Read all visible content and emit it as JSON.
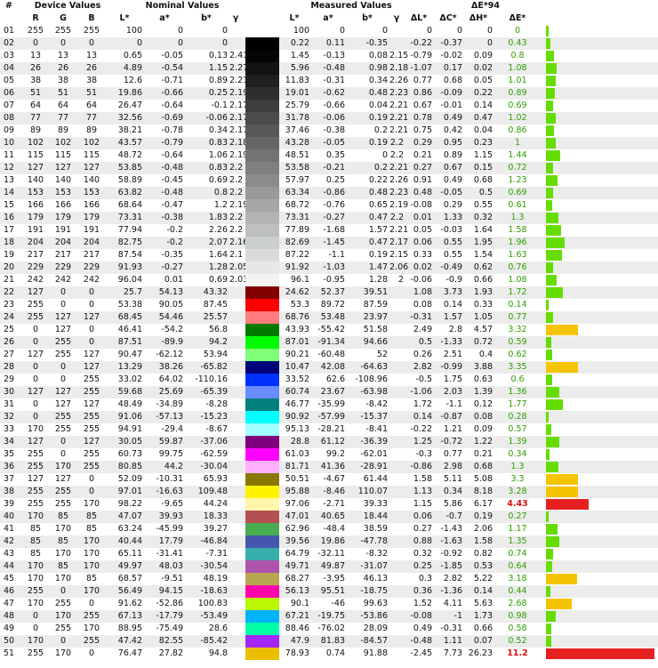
{
  "header": {
    "index_label": "#",
    "device_values": "Device Values",
    "nominal_values": "Nominal Values",
    "measured_values": "Measured Values",
    "de94_label": "ΔE*94",
    "cols": [
      "R",
      "G",
      "B",
      "L*",
      "a*",
      "b*",
      "γ",
      "L*",
      "a*",
      "b*",
      "γ",
      "ΔL*",
      "ΔC*",
      "ΔH*",
      "ΔE*"
    ]
  },
  "colors": {
    "row_alt": "#ececec",
    "bar_good": "#66dd00",
    "bar_warn": "#f5c400",
    "bar_bad": "#e62020",
    "value_green": "#2e9e00",
    "value_red": "#dd1111"
  },
  "chart_data": {
    "type": "table",
    "columns": [
      "#",
      "R",
      "G",
      "B",
      "Nominal L*",
      "Nominal a*",
      "Nominal b*",
      "Nominal γ",
      "Measured L*",
      "Measured a*",
      "Measured b*",
      "Measured γ",
      "ΔL*",
      "ΔC*",
      "ΔH*",
      "ΔE*"
    ],
    "bar_range": [
      0,
      11.2
    ],
    "rows": [
      [
        "01",
        "255",
        "255",
        "255",
        "100",
        "0",
        "0",
        "",
        "100",
        "0",
        "0",
        "",
        "0",
        "0",
        "0",
        "0"
      ],
      [
        "02",
        "0",
        "0",
        "0",
        "0",
        "0",
        "0",
        "",
        "0.22",
        "0.11",
        "-0.35",
        "",
        "-0.22",
        "-0.37",
        "0",
        "0.43"
      ],
      [
        "03",
        "13",
        "13",
        "13",
        "0.65",
        "-0.05",
        "0.13",
        "2.41",
        "1.45",
        "-0.13",
        "0.08",
        "2.15",
        "-0.79",
        "-0.02",
        "0.09",
        "0.8"
      ],
      [
        "04",
        "26",
        "26",
        "26",
        "4.89",
        "-0.54",
        "1.15",
        "2.27",
        "5.96",
        "-0.48",
        "0.98",
        "2.18",
        "-1.07",
        "0.17",
        "0.02",
        "1.08"
      ],
      [
        "05",
        "38",
        "38",
        "38",
        "12.6",
        "-0.71",
        "0.89",
        "2.21",
        "11.83",
        "-0.31",
        "0.34",
        "2.26",
        "0.77",
        "0.68",
        "0.05",
        "1.01"
      ],
      [
        "06",
        "51",
        "51",
        "51",
        "19.86",
        "-0.66",
        "0.25",
        "2.19",
        "19.01",
        "-0.62",
        "0.48",
        "2.23",
        "0.86",
        "-0.09",
        "0.22",
        "0.89"
      ],
      [
        "07",
        "64",
        "64",
        "64",
        "26.47",
        "-0.64",
        "-0.1",
        "2.17",
        "25.79",
        "-0.66",
        "0.04",
        "2.21",
        "0.67",
        "-0.01",
        "0.14",
        "0.69"
      ],
      [
        "08",
        "77",
        "77",
        "77",
        "32.56",
        "-0.69",
        "-0.06",
        "2.17",
        "31.78",
        "-0.06",
        "0.19",
        "2.21",
        "0.78",
        "0.49",
        "0.47",
        "1.02"
      ],
      [
        "09",
        "89",
        "89",
        "89",
        "38.21",
        "-0.78",
        "0.34",
        "2.17",
        "37.46",
        "-0.38",
        "0.2",
        "2.21",
        "0.75",
        "0.42",
        "0.04",
        "0.86"
      ],
      [
        "10",
        "102",
        "102",
        "102",
        "43.57",
        "-0.79",
        "0.83",
        "2.18",
        "43.28",
        "-0.05",
        "0.19",
        "2.2",
        "0.29",
        "0.95",
        "0.23",
        "1"
      ],
      [
        "11",
        "115",
        "115",
        "115",
        "48.72",
        "-0.64",
        "1.06",
        "2.19",
        "48.51",
        "0.35",
        "0",
        "2.2",
        "0.21",
        "0.89",
        "1.15",
        "1.44"
      ],
      [
        "12",
        "127",
        "127",
        "127",
        "53.85",
        "-0.48",
        "0.83",
        "2.2",
        "53.58",
        "-0.21",
        "0.2",
        "2.21",
        "0.27",
        "0.67",
        "0.15",
        "0.72"
      ],
      [
        "13",
        "140",
        "140",
        "140",
        "58.89",
        "-0.45",
        "0.69",
        "2.2",
        "57.97",
        "0.25",
        "0.22",
        "2.26",
        "0.91",
        "0.49",
        "0.68",
        "1.23"
      ],
      [
        "14",
        "153",
        "153",
        "153",
        "63.82",
        "-0.48",
        "0.8",
        "2.2",
        "63.34",
        "-0.86",
        "0.48",
        "2.23",
        "0.48",
        "-0.05",
        "0.5",
        "0.69"
      ],
      [
        "15",
        "166",
        "166",
        "166",
        "68.64",
        "-0.47",
        "1.2",
        "2.19",
        "68.72",
        "-0.76",
        "0.65",
        "2.19",
        "-0.08",
        "0.29",
        "0.55",
        "0.61"
      ],
      [
        "16",
        "179",
        "179",
        "179",
        "73.31",
        "-0.38",
        "1.83",
        "2.2",
        "73.31",
        "-0.27",
        "0.47",
        "2.2",
        "0.01",
        "1.33",
        "0.32",
        "1.3"
      ],
      [
        "17",
        "191",
        "191",
        "191",
        "77.94",
        "-0.2",
        "2.26",
        "2.2",
        "77.89",
        "-1.68",
        "1.57",
        "2.21",
        "0.05",
        "-0.03",
        "1.64",
        "1.58"
      ],
      [
        "18",
        "204",
        "204",
        "204",
        "82.75",
        "-0.2",
        "2.07",
        "2.16",
        "82.69",
        "-1.45",
        "0.47",
        "2.17",
        "0.06",
        "0.55",
        "1.95",
        "1.96"
      ],
      [
        "19",
        "217",
        "217",
        "217",
        "87.54",
        "-0.35",
        "1.64",
        "2.1",
        "87.22",
        "-1.1",
        "0.19",
        "2.15",
        "0.33",
        "0.55",
        "1.54",
        "1.63"
      ],
      [
        "20",
        "229",
        "229",
        "229",
        "91.93",
        "-0.27",
        "1.28",
        "2.05",
        "91.92",
        "-1.03",
        "1.47",
        "2.06",
        "0.02",
        "-0.49",
        "0.62",
        "0.76"
      ],
      [
        "21",
        "242",
        "242",
        "242",
        "96.04",
        "0.01",
        "0.69",
        "2.03",
        "96.1",
        "-0.95",
        "1.28",
        "2",
        "-0.06",
        "-0.9",
        "0.66",
        "1.08"
      ],
      [
        "22",
        "127",
        "0",
        "0",
        "25.7",
        "54.13",
        "43.32",
        "",
        "24.62",
        "52.37",
        "39.51",
        "",
        "1.08",
        "3.73",
        "1.93",
        "1.72"
      ],
      [
        "23",
        "255",
        "0",
        "0",
        "53.38",
        "90.05",
        "87.45",
        "",
        "53.3",
        "89.72",
        "87.59",
        "",
        "0.08",
        "0.14",
        "0.33",
        "0.14"
      ],
      [
        "24",
        "255",
        "127",
        "127",
        "68.45",
        "54.46",
        "25.57",
        "",
        "68.76",
        "53.48",
        "23.97",
        "",
        "-0.31",
        "1.57",
        "1.05",
        "0.77"
      ],
      [
        "25",
        "0",
        "127",
        "0",
        "46.41",
        "-54.2",
        "56.8",
        "",
        "43.93",
        "-55.42",
        "51.58",
        "",
        "2.49",
        "2.8",
        "4.57",
        "3.32"
      ],
      [
        "26",
        "0",
        "255",
        "0",
        "87.51",
        "-89.9",
        "94.2",
        "",
        "87.01",
        "-91.34",
        "94.66",
        "",
        "0.5",
        "-1.33",
        "0.72",
        "0.59"
      ],
      [
        "27",
        "127",
        "255",
        "127",
        "90.47",
        "-62.12",
        "53.94",
        "",
        "90.21",
        "-60.48",
        "52",
        "",
        "0.26",
        "2.51",
        "0.4",
        "0.62"
      ],
      [
        "28",
        "0",
        "0",
        "127",
        "13.29",
        "38.26",
        "-65.82",
        "",
        "10.47",
        "42.08",
        "-64.63",
        "",
        "2.82",
        "-0.99",
        "3.88",
        "3.35"
      ],
      [
        "29",
        "0",
        "0",
        "255",
        "33.02",
        "64.02",
        "-110.16",
        "",
        "33.52",
        "62.6",
        "-108.96",
        "",
        "-0.5",
        "1.75",
        "0.63",
        "0.6"
      ],
      [
        "30",
        "127",
        "127",
        "255",
        "59.68",
        "25.69",
        "-65.39",
        "",
        "60.74",
        "23.67",
        "-63.98",
        "",
        "-1.06",
        "2.03",
        "1.39",
        "1.36"
      ],
      [
        "31",
        "0",
        "127",
        "127",
        "48.49",
        "-34.89",
        "-8.28",
        "",
        "46.77",
        "-35.99",
        "-8.42",
        "",
        "1.72",
        "-1.1",
        "0.12",
        "1.77"
      ],
      [
        "32",
        "0",
        "255",
        "255",
        "91.06",
        "-57.13",
        "-15.23",
        "",
        "90.92",
        "-57.99",
        "-15.37",
        "",
        "0.14",
        "-0.87",
        "0.08",
        "0.28"
      ],
      [
        "33",
        "170",
        "255",
        "255",
        "94.91",
        "-29.4",
        "-8.67",
        "",
        "95.13",
        "-28.21",
        "-8.41",
        "",
        "-0.22",
        "1.21",
        "0.09",
        "0.57"
      ],
      [
        "34",
        "127",
        "0",
        "127",
        "30.05",
        "59.87",
        "-37.06",
        "",
        "28.8",
        "61.12",
        "-36.39",
        "",
        "1.25",
        "-0.72",
        "1.22",
        "1.39"
      ],
      [
        "35",
        "255",
        "0",
        "255",
        "60.73",
        "99.75",
        "-62.59",
        "",
        "61.03",
        "99.2",
        "-62.01",
        "",
        "-0.3",
        "0.77",
        "0.21",
        "0.34"
      ],
      [
        "36",
        "255",
        "170",
        "255",
        "80.85",
        "44.2",
        "-30.04",
        "",
        "81.71",
        "41.36",
        "-28.91",
        "",
        "-0.86",
        "2.98",
        "0.68",
        "1.3"
      ],
      [
        "37",
        "127",
        "127",
        "0",
        "52.09",
        "-10.31",
        "65.93",
        "",
        "50.51",
        "-4.67",
        "61.44",
        "",
        "1.58",
        "5.11",
        "5.08",
        "3.3"
      ],
      [
        "38",
        "255",
        "255",
        "0",
        "97.01",
        "-16.63",
        "109.48",
        "",
        "95.88",
        "-8.46",
        "110.07",
        "",
        "1.13",
        "0.34",
        "8.18",
        "3.28"
      ],
      [
        "39",
        "255",
        "255",
        "170",
        "98.22",
        "-9.65",
        "44.24",
        "",
        "97.06",
        "-2.71",
        "39.33",
        "",
        "1.15",
        "5.86",
        "6.17",
        "4.43"
      ],
      [
        "40",
        "170",
        "85",
        "85",
        "47.07",
        "39.93",
        "18.33",
        "",
        "47.01",
        "40.65",
        "18.44",
        "",
        "0.06",
        "-0.7",
        "0.19",
        "0.27"
      ],
      [
        "41",
        "85",
        "170",
        "85",
        "63.24",
        "-45.99",
        "39.27",
        "",
        "62.96",
        "-48.4",
        "38.59",
        "",
        "0.27",
        "-1.43",
        "2.06",
        "1.17"
      ],
      [
        "42",
        "85",
        "85",
        "170",
        "40.44",
        "17.79",
        "-46.84",
        "",
        "39.56",
        "19.86",
        "-47.78",
        "",
        "0.88",
        "-1.63",
        "1.58",
        "1.35"
      ],
      [
        "43",
        "85",
        "170",
        "170",
        "65.11",
        "-31.41",
        "-7.31",
        "",
        "64.79",
        "-32.11",
        "-8.32",
        "",
        "0.32",
        "-0.92",
        "0.82",
        "0.74"
      ],
      [
        "44",
        "170",
        "85",
        "170",
        "49.97",
        "48.03",
        "-30.54",
        "",
        "49.71",
        "49.87",
        "-31.07",
        "",
        "0.25",
        "-1.85",
        "0.53",
        "0.64"
      ],
      [
        "45",
        "170",
        "170",
        "85",
        "68.57",
        "-9.51",
        "48.19",
        "",
        "68.27",
        "-3.95",
        "46.13",
        "",
        "0.3",
        "2.82",
        "5.22",
        "3.18"
      ],
      [
        "46",
        "255",
        "0",
        "170",
        "56.49",
        "94.15",
        "-18.63",
        "",
        "56.13",
        "95.51",
        "-18.75",
        "",
        "0.36",
        "-1.36",
        "0.14",
        "0.44"
      ],
      [
        "47",
        "170",
        "255",
        "0",
        "91.62",
        "-52.86",
        "100.83",
        "",
        "90.1",
        "-46",
        "99.63",
        "",
        "1.52",
        "4.11",
        "5.63",
        "2.68"
      ],
      [
        "48",
        "0",
        "170",
        "255",
        "67.13",
        "-17.79",
        "-53.49",
        "",
        "67.21",
        "-19.75",
        "-53.86",
        "",
        "-0.08",
        "-1",
        "1.73",
        "0.98"
      ],
      [
        "49",
        "0",
        "255",
        "170",
        "88.95",
        "-75.49",
        "28.6",
        "",
        "88.46",
        "-76.02",
        "28.09",
        "",
        "0.49",
        "-0.31",
        "0.66",
        "0.58"
      ],
      [
        "50",
        "170",
        "0",
        "255",
        "47.42",
        "82.55",
        "-85.42",
        "",
        "47.9",
        "81.83",
        "-84.57",
        "",
        "-0.48",
        "1.11",
        "0.07",
        "0.52"
      ],
      [
        "51",
        "255",
        "170",
        "0",
        "76.47",
        "27.82",
        "94.8",
        "",
        "78.93",
        "0.74",
        "91.88",
        "",
        "-2.45",
        "7.73",
        "26.23",
        "11.2"
      ]
    ]
  }
}
